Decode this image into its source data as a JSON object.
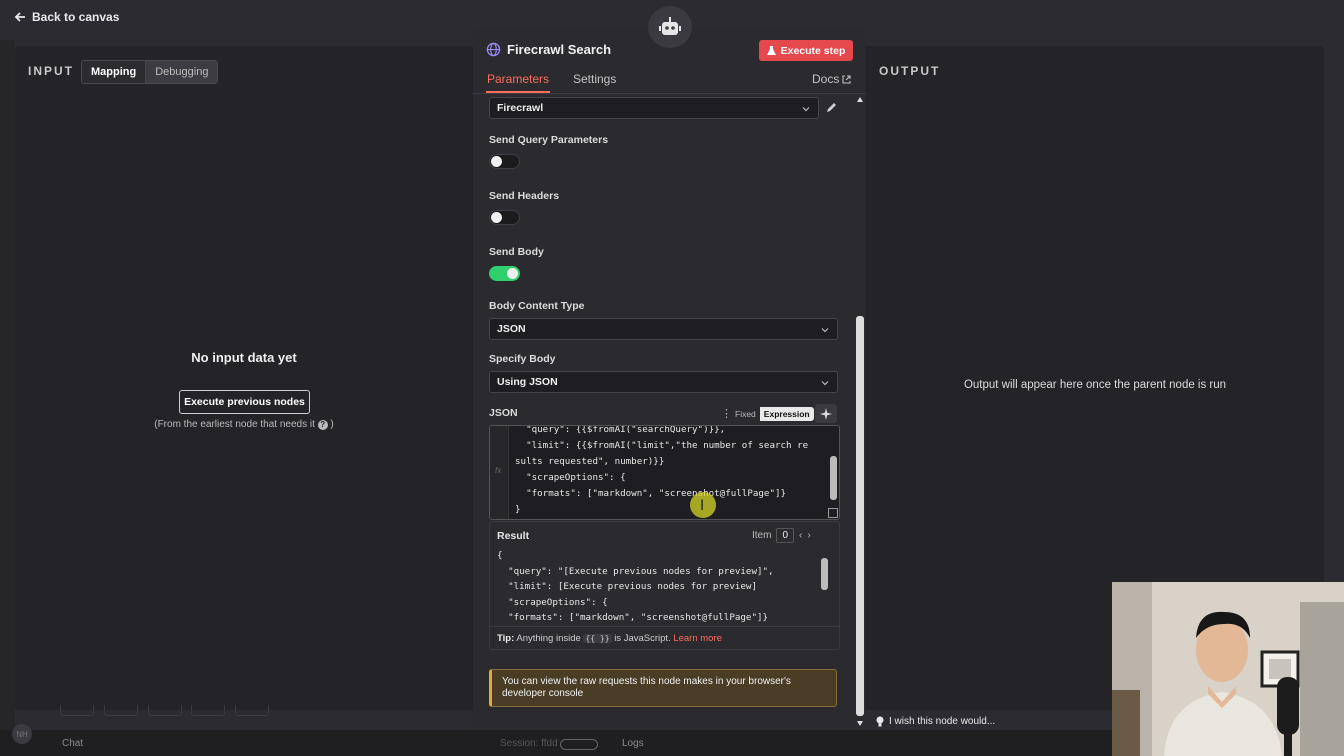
{
  "topbar": {
    "back_label": "Back to canvas"
  },
  "input_panel": {
    "title": "INPUT",
    "tabs": [
      "Mapping",
      "Debugging"
    ],
    "empty_title": "No input data yet",
    "execute_button": "Execute previous nodes",
    "execute_note": "(From the earliest node that needs it",
    "help_icon": "question-icon"
  },
  "output_panel": {
    "title": "OUTPUT",
    "message": "Output will appear here once the parent node is run"
  },
  "node": {
    "title": "Firecrawl Search",
    "execute_step": "Execute step",
    "tabs": {
      "parameters": "Parameters",
      "settings": "Settings",
      "docs": "Docs"
    },
    "credential": "Firecrawl",
    "send_query_label": "Send Query Parameters",
    "send_query_on": false,
    "send_headers_label": "Send Headers",
    "send_headers_on": false,
    "send_body_label": "Send Body",
    "send_body_on": true,
    "body_content_type_label": "Body Content Type",
    "body_content_type": "JSON",
    "specify_body_label": "Specify Body",
    "specify_body": "Using JSON",
    "json_label": "JSON",
    "mode_fixed": "Fixed",
    "mode_expression": "Expression",
    "json_lines": [
      "  \"query\": {{$fromAI(\"searchQuery\")}},",
      "  \"limit\": {{$fromAI(\"limit\",\"the number of search re",
      "sults requested\", number)}}",
      "  \"scrapeOptions\": {",
      "  \"formats\": [\"markdown\", \"screenshot@fullPage\"]}",
      "}"
    ],
    "result_label": "Result",
    "item_label": "Item",
    "item_index": "0",
    "result_lines": [
      "{",
      "  \"query\": \"[Execute previous nodes for preview]\",",
      "  \"limit\": [Execute previous nodes for preview]",
      "  \"scrapeOptions\": {",
      "  \"formats\": [\"markdown\", \"screenshot@fullPage\"]}"
    ],
    "tip_prefix": "Tip:",
    "tip_text": "Anything inside",
    "tip_braces": "{{ }}",
    "tip_suffix": "is JavaScript.",
    "tip_link": "Learn more",
    "notice": "You can view the raw requests this node makes in your browser's developer console"
  },
  "footer": {
    "chat": "Chat",
    "session": "Session: ffdd",
    "logs": "Logs",
    "avatar": "NH",
    "wish": "I wish this node would..."
  },
  "colors": {
    "accent": "#ff6d5a",
    "execute": "#e5484d",
    "toggle_on": "#2fd06d",
    "notice_bg": "#4a3c25"
  }
}
